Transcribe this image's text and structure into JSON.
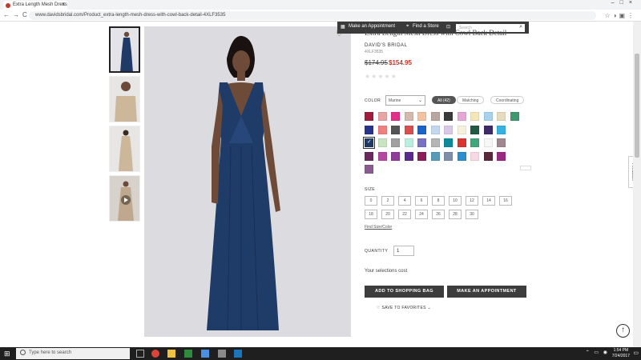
{
  "browser": {
    "tab_title": "Extra Length Mesh Dress",
    "tab_close": "x",
    "window_controls": "–□×",
    "nav_icons": "←→C",
    "url": "www.davidsbridal.com/Product_extra-length-mesh-dress-with-cowl-back-detail-4XLF3535",
    "extension_icons": "☆◑▣⋮"
  },
  "toolbar": {
    "appointment_label": "Make an Appointment",
    "store_label": "Find a Store",
    "search_placeholder": "Search"
  },
  "product": {
    "title": "Extra Length Mesh Dress with Cowl Back Detail",
    "brand": "DAVID'S BRIDAL",
    "sku": "4XLF3535",
    "old_price": "$174.95",
    "new_price": "$154.95",
    "stars": "★★★★★"
  },
  "color": {
    "label": "COLOR",
    "selected": "Marine",
    "filters": [
      "All (42)",
      "Matching",
      "Coordinating"
    ],
    "swatches": [
      [
        "#a01c3a",
        "#e8a5a5",
        "#e0308a",
        "#d4b9ae",
        "#f5c2a0",
        "#b8a7a0",
        "#3a3a3a",
        "#e6a6d6",
        "#f5e6b8",
        "#a9d2ec",
        "#e5dcc0",
        "#3e9a6e"
      ],
      [
        "#28358c",
        "#f08080",
        "#555",
        "#d94f4f",
        "#1a63c8",
        "#c3d8ef",
        "#d9c9e6",
        "#f5f1dc",
        "#1f5a45",
        "#3d2a68",
        "#38b0e0"
      ],
      [
        "#1f3a66",
        "#c9e4c0",
        "#a0a0a0",
        "#b8eee0",
        "#7a70c8",
        "#b5b5b5",
        "#0c8b9b",
        "#d9362e",
        "#3fa87a",
        "#f7f7f7",
        "#a08890"
      ],
      [
        "#6a2a60",
        "#b34aa0",
        "#8e3c9a",
        "#5a2a90",
        "#8e1e5a",
        "#5a9ab8",
        "#7f8fa8",
        "#2a8ed0",
        "#f8d8e4",
        "#5a2a3a",
        "#9a2a80"
      ],
      [
        "#8a5a90"
      ]
    ],
    "selected_index": [
      2,
      0
    ]
  },
  "size": {
    "label": "SIZE",
    "options_row1": [
      "0",
      "2",
      "4",
      "6",
      "8",
      "10",
      "12",
      "14",
      "16"
    ],
    "options_row2": [
      "18",
      "20",
      "22",
      "24",
      "26",
      "28",
      "30"
    ],
    "chart_link": "Find Size/Color"
  },
  "quantity": {
    "label": "QUANTITY",
    "value": "1"
  },
  "selection_cost": "Your selections cost",
  "buttons": {
    "add_to_bag": "ADD TO SHOPPING BAG",
    "appointment": "MAKE AN APPOINTMENT",
    "save_fav": "♡ SAVE TO FAVORITES ⌄"
  },
  "feedback_label": "Feedback",
  "taskbar": {
    "search_placeholder": "Type here to search",
    "start_glyph": "⊞",
    "tray_icons": "⌃ ▭ ◉",
    "time": "1:54 PM",
    "date": "7/24/2017",
    "notif_icon": "▭"
  }
}
